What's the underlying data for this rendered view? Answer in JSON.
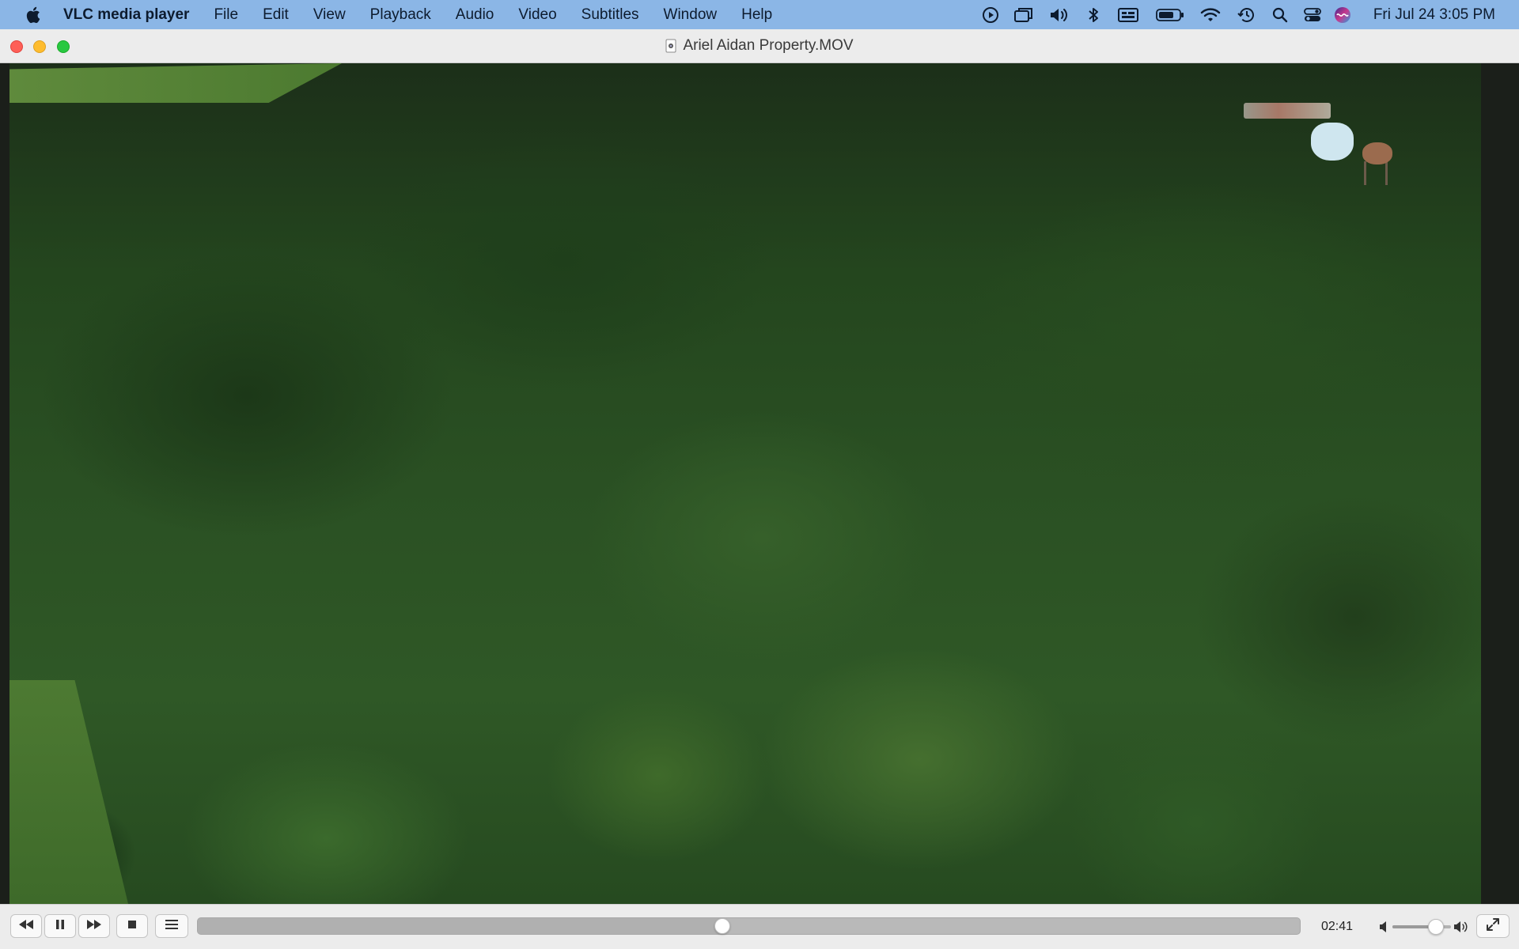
{
  "menubar": {
    "app_name": "VLC media player",
    "items": [
      "File",
      "Edit",
      "View",
      "Playback",
      "Audio",
      "Video",
      "Subtitles",
      "Window",
      "Help"
    ],
    "status_icons": [
      "play-circle-icon",
      "screen-mirror-icon",
      "volume-icon",
      "bluetooth-icon",
      "keyboard-input-icon",
      "battery-icon",
      "wifi-icon",
      "time-machine-icon",
      "spotlight-search-icon",
      "control-center-icon",
      "siri-icon"
    ],
    "clock": "Fri Jul 24  3:05 PM",
    "background": "#8bb6e6"
  },
  "window": {
    "title": "Ariel Aidan Property.MOV"
  },
  "controls": {
    "time": "02:41",
    "progress": 0.476,
    "volume": 0.74
  }
}
